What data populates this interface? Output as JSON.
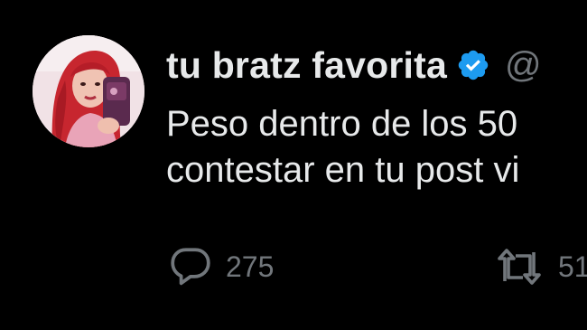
{
  "tweet": {
    "author": {
      "display_name": "tu bratz favorita",
      "handle": "@",
      "verified": true,
      "avatar_icon": "profile-photo"
    },
    "text_lines": [
      "Peso dentro de los 50",
      "contestar en tu post vi"
    ],
    "actions": {
      "reply": {
        "icon": "speech-bubble-icon",
        "count": "275"
      },
      "retweet": {
        "icon": "retweet-arrows-icon",
        "count": "51"
      }
    }
  },
  "colors": {
    "background": "#000000",
    "primary_text": "#e7e9ea",
    "secondary_text": "#71767b",
    "verified_blue": "#1d9bf0"
  }
}
